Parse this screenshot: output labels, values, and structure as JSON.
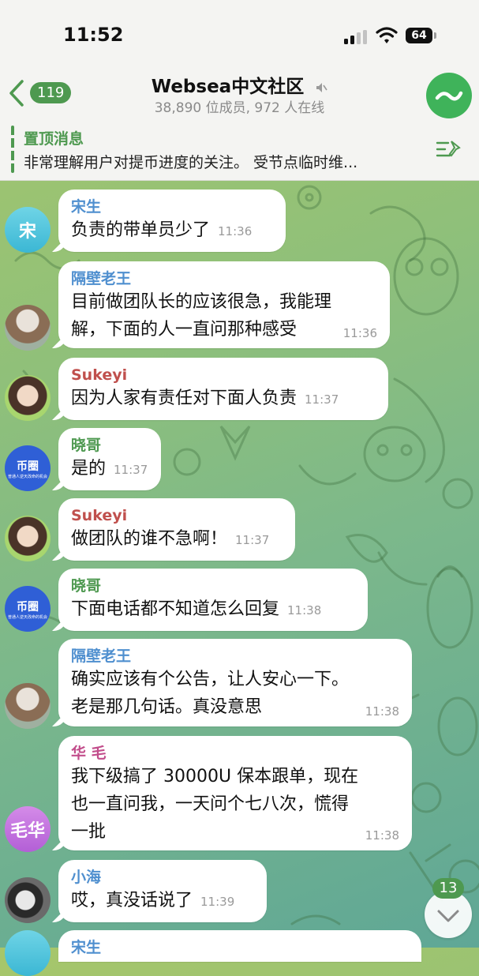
{
  "status_bar": {
    "time": "11:52",
    "battery": "64"
  },
  "header": {
    "back_count": "119",
    "title": "Websea中文社区",
    "subtitle": "38,890 位成员, 972 人在线",
    "muted_icon": "mute-icon"
  },
  "pinned": {
    "title": "置顶消息",
    "text": "非常理解用户对提币进度的关注。 受节点临时维..."
  },
  "messages": [
    {
      "sender": "宋生",
      "text": "负责的带单员少了",
      "time": "11:36",
      "avatar_text": "宋"
    },
    {
      "sender": "隔壁老王",
      "lines": [
        "目前做团队长的应该很急，我能理",
        "解，下面的人一直问那种感受"
      ],
      "time": "11:36"
    },
    {
      "sender": "Sukeyi",
      "text": "因为人家有责任对下面人负责",
      "time": "11:37"
    },
    {
      "sender": "晓哥",
      "text": "是的",
      "time": "11:37",
      "avatar_text": "币圈",
      "avatar_sub": "普通人逆天改命的机会"
    },
    {
      "sender": "Sukeyi",
      "text": "做团队的谁不急啊！",
      "time": "11:37"
    },
    {
      "sender": "晓哥",
      "text": "下面电话都不知道怎么回复",
      "time": "11:38",
      "avatar_text": "币圈",
      "avatar_sub": "普通人逆天改命的机会"
    },
    {
      "sender": "隔壁老王",
      "lines": [
        "确实应该有个公告，让人安心一下。",
        "老是那几句话。真没意思"
      ],
      "time": "11:38"
    },
    {
      "sender": "华 毛",
      "lines": [
        "我下级搞了 30000U 保本跟单，现在",
        "也一直问我，一天问个七八次，慌得",
        "一批"
      ],
      "time": "11:38",
      "avatar_text": "毛华"
    },
    {
      "sender": "小海",
      "text": "哎，真没话说了",
      "time": "11:39"
    },
    {
      "sender": "宋生"
    }
  ],
  "unread_count": "13",
  "colors": {
    "accent": "#4e9950",
    "header_bg": "#f4f4f2"
  }
}
